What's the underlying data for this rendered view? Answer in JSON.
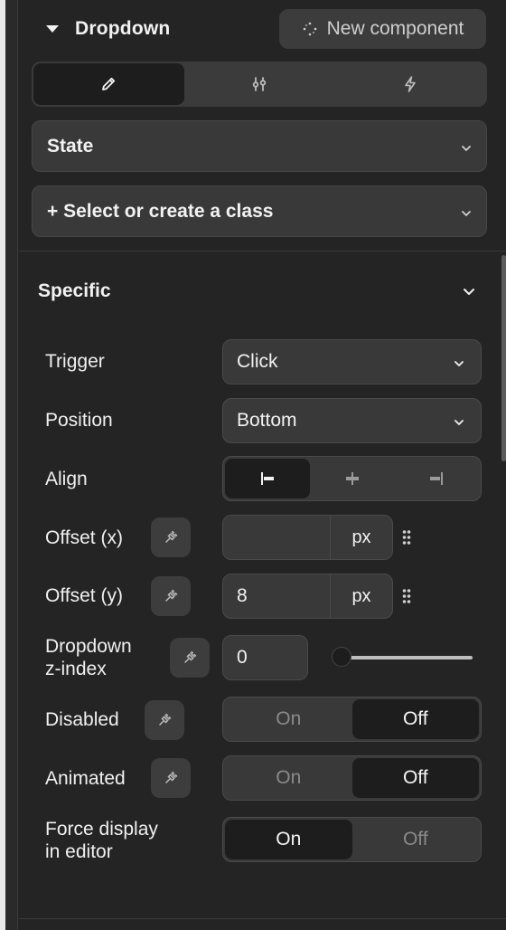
{
  "header": {
    "title": "Dropdown",
    "new_component_label": "New component"
  },
  "tabs": [
    {
      "icon": "pencil-icon",
      "active": true
    },
    {
      "icon": "sliders-icon",
      "active": false
    },
    {
      "icon": "lightning-icon",
      "active": false
    }
  ],
  "state_select": {
    "label": "State"
  },
  "class_select": {
    "label": "+ Select or create a class"
  },
  "section": {
    "title": "Specific"
  },
  "fields": {
    "trigger": {
      "label": "Trigger",
      "value": "Click"
    },
    "position": {
      "label": "Position",
      "value": "Bottom"
    },
    "align": {
      "label": "Align",
      "options": [
        "align-start-icon",
        "align-center-icon",
        "align-end-icon"
      ],
      "active_index": 0
    },
    "offset_x": {
      "label": "Offset (x)",
      "value": "",
      "unit": "px"
    },
    "offset_y": {
      "label": "Offset (y)",
      "value": "8",
      "unit": "px"
    },
    "zindex": {
      "label_line1": "Dropdown",
      "label_line2": "z-index",
      "value": "0",
      "slider_level": 0
    },
    "disabled": {
      "label": "Disabled",
      "on": "On",
      "off": "Off",
      "selected": "Off"
    },
    "animated": {
      "label": "Animated",
      "on": "On",
      "off": "Off",
      "selected": "Off"
    },
    "force_display": {
      "label_line1": "Force display",
      "label_line2": "in editor",
      "on": "On",
      "off": "Off",
      "selected": "On"
    }
  },
  "colors": {
    "panel_bg": "#242424",
    "field_bg": "#393939",
    "active_bg": "#1d1d1d",
    "text": "#f2f2f2",
    "muted_text": "#8a8a8a"
  }
}
